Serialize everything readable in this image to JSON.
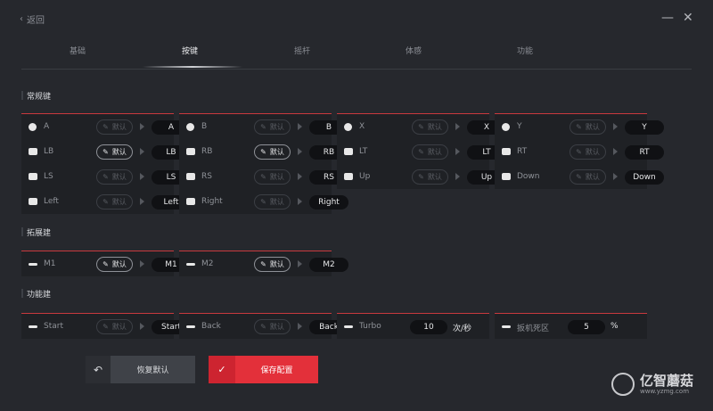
{
  "header": {
    "back_label": "返回",
    "minimize": "—",
    "close": "✕"
  },
  "tabs": [
    {
      "label": "基础"
    },
    {
      "label": "按键"
    },
    {
      "label": "摇杆"
    },
    {
      "label": "体感"
    },
    {
      "label": "功能"
    }
  ],
  "active_tab": "按键",
  "sections": {
    "regular": {
      "title": "常规键"
    },
    "extended": {
      "title": "拓展建"
    },
    "function": {
      "title": "功能建"
    }
  },
  "default_label": "默认",
  "regular_keys": [
    [
      {
        "label": "A",
        "value": "A",
        "icon": "circle-icon",
        "default_on": false
      },
      {
        "label": "LB",
        "value": "LB",
        "icon": "bumper-icon",
        "default_on": true
      },
      {
        "label": "LS",
        "value": "LS",
        "icon": "stick-icon",
        "default_on": false
      },
      {
        "label": "Left",
        "value": "Left",
        "icon": "dpad-icon",
        "default_on": false
      }
    ],
    [
      {
        "label": "B",
        "value": "B",
        "icon": "circle-icon",
        "default_on": false
      },
      {
        "label": "RB",
        "value": "RB",
        "icon": "bumper-icon",
        "default_on": true
      },
      {
        "label": "RS",
        "value": "RS",
        "icon": "stick-icon",
        "default_on": false
      },
      {
        "label": "Right",
        "value": "Right",
        "icon": "dpad-icon",
        "default_on": false
      }
    ],
    [
      {
        "label": "X",
        "value": "X",
        "icon": "circle-icon",
        "default_on": false
      },
      {
        "label": "LT",
        "value": "LT",
        "icon": "trigger-icon",
        "default_on": false
      },
      {
        "label": "Up",
        "value": "Up",
        "icon": "dpad-icon",
        "default_on": false
      }
    ],
    [
      {
        "label": "Y",
        "value": "Y",
        "icon": "circle-icon",
        "default_on": false
      },
      {
        "label": "RT",
        "value": "RT",
        "icon": "trigger-icon",
        "default_on": false
      },
      {
        "label": "Down",
        "value": "Down",
        "icon": "dpad-icon",
        "default_on": false
      }
    ]
  ],
  "extended_keys": [
    {
      "label": "M1",
      "value": "M1",
      "icon": "paddle-icon",
      "default_on": true
    },
    {
      "label": "M2",
      "value": "M2",
      "icon": "paddle-icon",
      "default_on": true
    }
  ],
  "function_keys": [
    {
      "label": "Start",
      "value": "Start",
      "icon": "start-icon",
      "default_on": false
    },
    {
      "label": "Back",
      "value": "Back",
      "icon": "back-icon",
      "default_on": false
    }
  ],
  "turbo": {
    "label": "Turbo",
    "value": "10",
    "unit": "次/秒"
  },
  "trigger_deadzone": {
    "label": "扳机死区",
    "value": "5",
    "unit": "%"
  },
  "actions": {
    "restore_label": "恢复默认",
    "save_label": "保存配置"
  },
  "watermark": {
    "brand": "亿智蘑菇",
    "url": "www.yzmg.com"
  },
  "colors": {
    "accent": "#e3303a",
    "background": "#26282d",
    "card": "#1f2125"
  }
}
